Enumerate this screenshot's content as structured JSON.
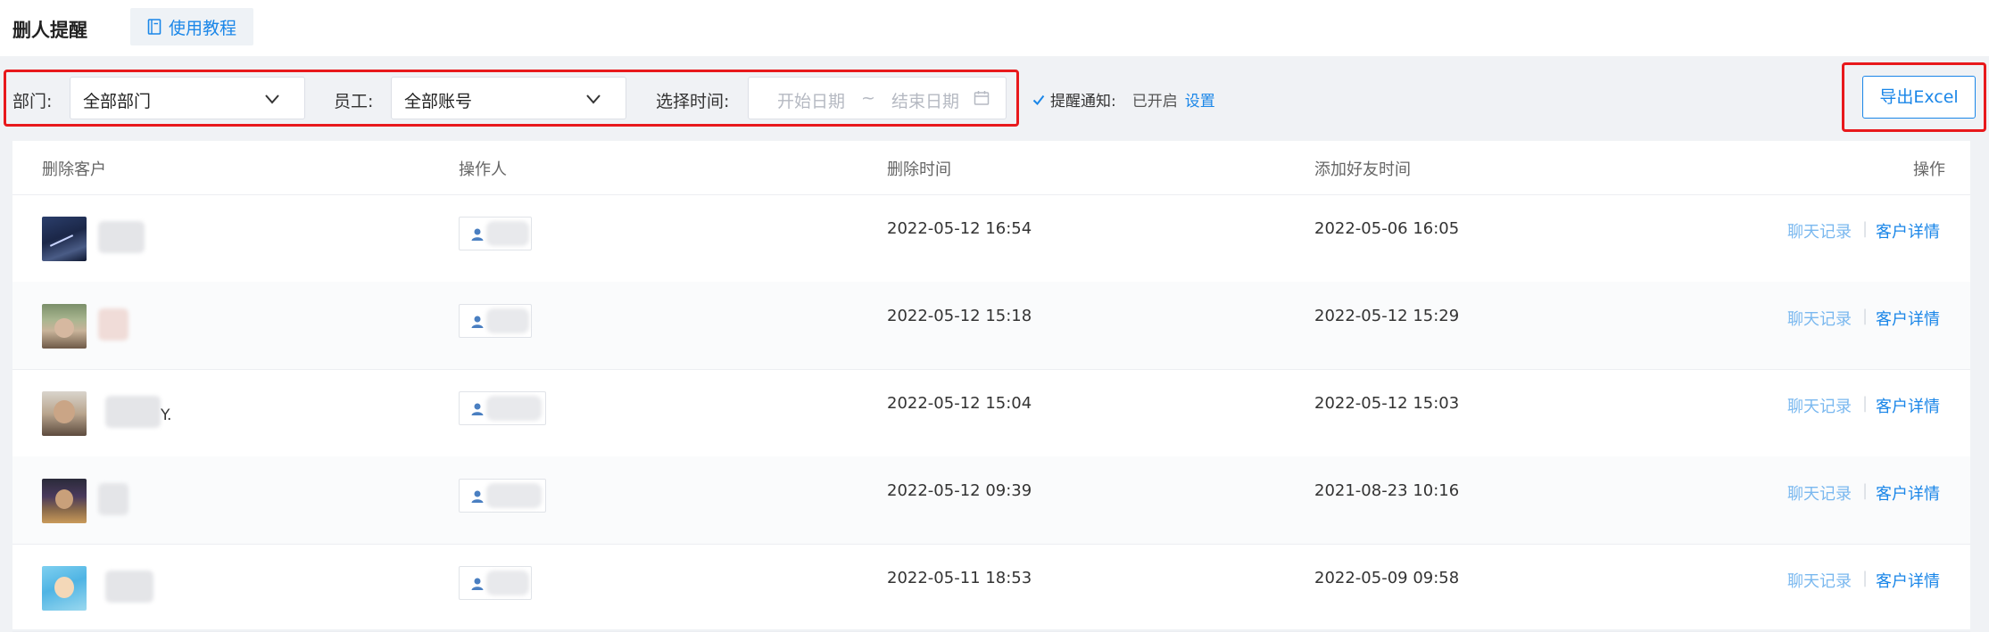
{
  "header": {
    "title": "删人提醒",
    "tutorial_tab": "使用教程"
  },
  "filters": {
    "dept_label": "部门:",
    "dept_value": "全部部门",
    "staff_label": "员工:",
    "staff_value": "全部账号",
    "time_label": "选择时间:",
    "start_placeholder": "开始日期",
    "range_sep": "~",
    "end_placeholder": "结束日期"
  },
  "notice": {
    "label": "提醒通知:",
    "status": "已开启",
    "settings": "设置"
  },
  "export_label": "导出Excel",
  "table": {
    "columns": [
      "删除客户",
      "操作人",
      "删除时间",
      "添加好友时间",
      "操作"
    ],
    "actions": {
      "chat": "聊天记录",
      "sep": "|",
      "detail": "客户详情"
    },
    "rows": [
      {
        "customer": "",
        "delete_time": "2022-05-12 16:54",
        "add_time": "2022-05-06 16:05"
      },
      {
        "customer": "",
        "delete_time": "2022-05-12 15:18",
        "add_time": "2022-05-12 15:29"
      },
      {
        "customer": "Y.",
        "delete_time": "2022-05-12 15:04",
        "add_time": "2022-05-12 15:03"
      },
      {
        "customer": "",
        "delete_time": "2022-05-12 09:39",
        "add_time": "2021-08-23 10:16"
      },
      {
        "customer": "",
        "delete_time": "2022-05-11 18:53",
        "add_time": "2022-05-09 09:58"
      }
    ]
  },
  "colors": {
    "accent": "#1a86e8",
    "highlight": "#e8191c",
    "muted_link": "#7ab8ef"
  }
}
